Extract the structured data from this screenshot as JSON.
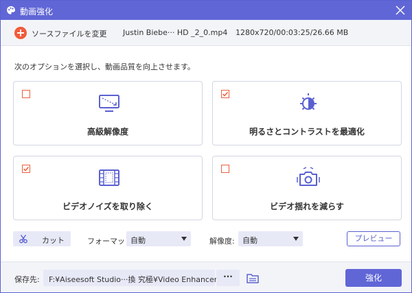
{
  "window": {
    "title": "動画強化",
    "icons": {
      "app": "palette-icon",
      "close": "close-icon"
    }
  },
  "file_bar": {
    "change_source_label": "ソースファイルを変更",
    "file_name": "Justin Biebe··· HD _2_0.mp4",
    "file_info": "1280x720/00:03:25/26.66 MB",
    "icon": "plus-circle-icon"
  },
  "instruction": "次のオプションを選択し、動画品質を向上させます。",
  "options": [
    {
      "label": "高級解像度",
      "checked": false,
      "icon": "monitor-upscale-icon"
    },
    {
      "label": "明るさとコントラストを最適化",
      "checked": true,
      "icon": "brightness-icon"
    },
    {
      "label": "ビデオノイズを取り除く",
      "checked": true,
      "icon": "film-icon"
    },
    {
      "label": "ビデオ揺れを減らす",
      "checked": false,
      "icon": "shake-camera-icon"
    }
  ],
  "settings": {
    "cut_label": "カット",
    "format_label": "フォーマット:",
    "format_value": "自動",
    "resolution_label": "解像度:",
    "resolution_value": "自動",
    "preview_label": "プレビュー"
  },
  "footer": {
    "save_label": "保存先:",
    "path": "F:¥Aiseesoft Studio···換 究極¥Video Enhancer",
    "browse_label": "···",
    "enhance_label": "強化"
  },
  "colors": {
    "accent": "#6066d6",
    "checkbox": "#e8603f",
    "add_button": "#f25a3b"
  }
}
